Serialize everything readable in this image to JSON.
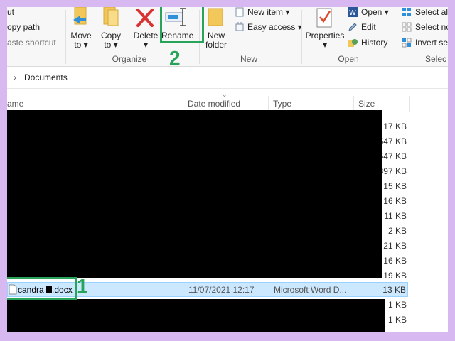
{
  "ribbon": {
    "clipboard": {
      "cut": "ut",
      "copy_path": "opy path",
      "paste_shortcut": "aste shortcut"
    },
    "organize": {
      "move_to": "Move",
      "move_to2": "to",
      "copy_to": "Copy",
      "copy_to2": "to",
      "delete": "Delete",
      "rename": "Rename",
      "label": "Organize"
    },
    "new": {
      "new_folder": "New",
      "new_folder2": "folder",
      "new_item": "New item",
      "easy_access": "Easy access",
      "label": "New"
    },
    "open": {
      "properties": "Properties",
      "open": "Open",
      "edit": "Edit",
      "history": "History",
      "label": "Open"
    },
    "select": {
      "select_all": "Select all",
      "select_none": "Select no",
      "invert": "Invert sel",
      "label": "Selec"
    }
  },
  "address": {
    "folder": "Documents"
  },
  "columns": {
    "name": "ame",
    "date": "Date modified",
    "type": "Type",
    "size": "Size"
  },
  "sizes": [
    "17 KB",
    "547 KB",
    "547 KB",
    "397 KB",
    "15 KB",
    "16 KB",
    "11 KB",
    "2 KB",
    "21 KB",
    "16 KB",
    "19 KB"
  ],
  "selected_file": {
    "name_prefix": "candra",
    "name_suffix": ".docx",
    "date": "11/07/2021 12:17",
    "type": "Microsoft Word D...",
    "size": "13 KB"
  },
  "sizes_after": [
    "1 KB",
    "1 KB"
  ],
  "annotations": {
    "step1": "1",
    "step2": "2"
  },
  "colors": {
    "accent_green": "#27a35a",
    "selection": "#cce8ff",
    "background": "#d8b8f0"
  }
}
